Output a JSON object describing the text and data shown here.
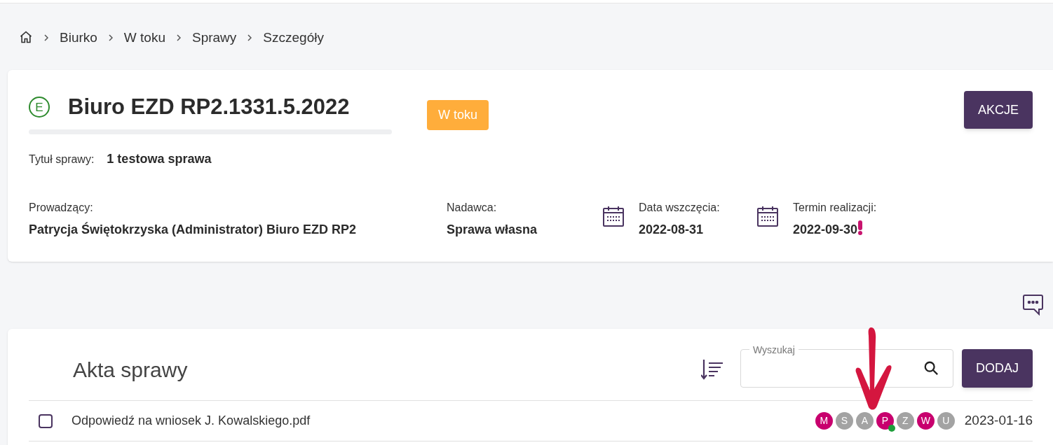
{
  "breadcrumb": [
    "Biurko",
    "W toku",
    "Sprawy",
    "Szczegóły"
  ],
  "case": {
    "badge_letter": "E",
    "number": "Biuro EZD RP2.1331.5.2022",
    "status": "W toku",
    "actions_button": "AKCJE",
    "title_label": "Tytuł sprawy:",
    "title_value": "1 testowa sprawa",
    "fields": [
      {
        "kind": "text",
        "label": "Prowadzący:",
        "value": "Patrycja Świętokrzyska (Administrator) Biuro EZD RP2",
        "overdue": false
      },
      {
        "kind": "text",
        "label": "Nadawca:",
        "value": "Sprawa własna",
        "overdue": false
      },
      {
        "kind": "date",
        "label": "Data wszczęcia:",
        "value": "2022-08-31",
        "overdue": false
      },
      {
        "kind": "date",
        "label": "Termin realizacji:",
        "value": "2022-09-30",
        "overdue": true
      }
    ]
  },
  "files": {
    "title": "Akta sprawy",
    "search": {
      "label": "Wyszukaj"
    },
    "add_button": "DODAJ",
    "rows": [
      {
        "name": "Odpowiedź na wniosek J. Kowalskiego.pdf",
        "checked": false,
        "date": "2023-01-16",
        "flags": [
          {
            "letter": "M",
            "active": true,
            "dot": false
          },
          {
            "letter": "S",
            "active": false,
            "dot": false
          },
          {
            "letter": "A",
            "active": false,
            "dot": false
          },
          {
            "letter": "P",
            "active": true,
            "dot": true
          },
          {
            "letter": "Z",
            "active": false,
            "dot": false
          },
          {
            "letter": "W",
            "active": true,
            "dot": false
          },
          {
            "letter": "U",
            "active": false,
            "dot": false
          }
        ]
      }
    ]
  }
}
